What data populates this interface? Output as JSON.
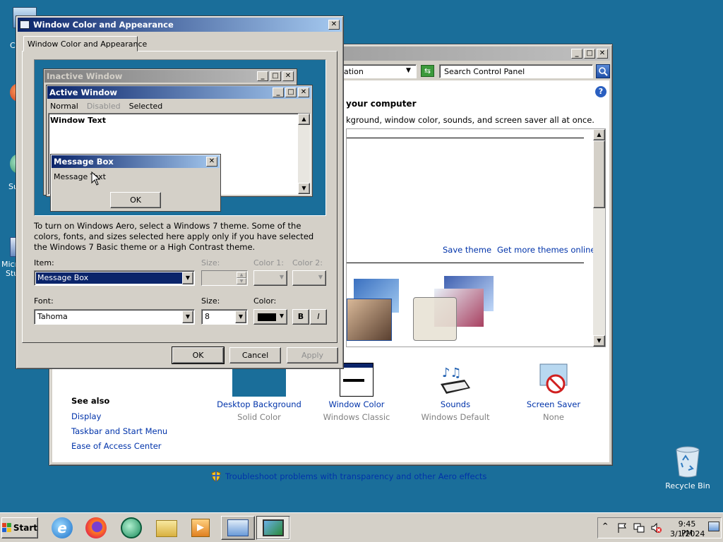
{
  "desktop": {
    "recycle_bin_label": "Recycle Bin",
    "partial_labels": [
      "C",
      "Su",
      "Micr",
      "Stu"
    ]
  },
  "cpanel": {
    "search_placeholder": "Search Control Panel",
    "address_text": "ation",
    "heading": "your computer",
    "subtext": "kground, window color, sounds, and screen saver all at once.",
    "save_theme": "Save theme",
    "get_more_themes": "Get more themes online",
    "see_also_title": "See also",
    "see_also": [
      "Display",
      "Taskbar and Start Menu",
      "Ease of Access Center"
    ],
    "bottom_items": [
      {
        "title": "Desktop Background",
        "sub": "Solid Color"
      },
      {
        "title": "Window Color",
        "sub": "Windows Classic"
      },
      {
        "title": "Sounds",
        "sub": "Windows Default"
      },
      {
        "title": "Screen Saver",
        "sub": "None"
      }
    ],
    "troubleshoot": "Troubleshoot problems with transparency and other Aero effects"
  },
  "dialog": {
    "title": "Window Color and Appearance",
    "tab": "Window Color and Appearance",
    "preview": {
      "inactive_title": "Inactive Window",
      "active_title": "Active Window",
      "menu": [
        "Normal",
        "Disabled",
        "Selected"
      ],
      "window_text": "Window Text",
      "msgbox_title": "Message Box",
      "msgbox_text": "Message Text",
      "msgbox_ok": "OK"
    },
    "info": "To turn on Windows Aero, select a Windows 7 theme.  Some of the colors, fonts, and sizes selected here apply only if you have selected the Windows 7 Basic theme or a High Contrast theme.",
    "item_label": "Item:",
    "item_value": "Message Box",
    "size_label": "Size:",
    "color1_label": "Color 1:",
    "color2_label": "Color 2:",
    "font_label": "Font:",
    "font_value": "Tahoma",
    "font_size_label": "Size:",
    "font_size_value": "8",
    "font_color_label": "Color:",
    "bold": "B",
    "italic": "I",
    "ok": "OK",
    "cancel": "Cancel",
    "apply": "Apply"
  },
  "taskbar": {
    "start": "Start",
    "time": "9:45 PM",
    "date": "3/1/2024"
  },
  "colors": {
    "desktop": "#1a6e9a",
    "active_title_start": "#0a246a",
    "active_title_end": "#a6caf0",
    "selection": "#0a246a"
  }
}
